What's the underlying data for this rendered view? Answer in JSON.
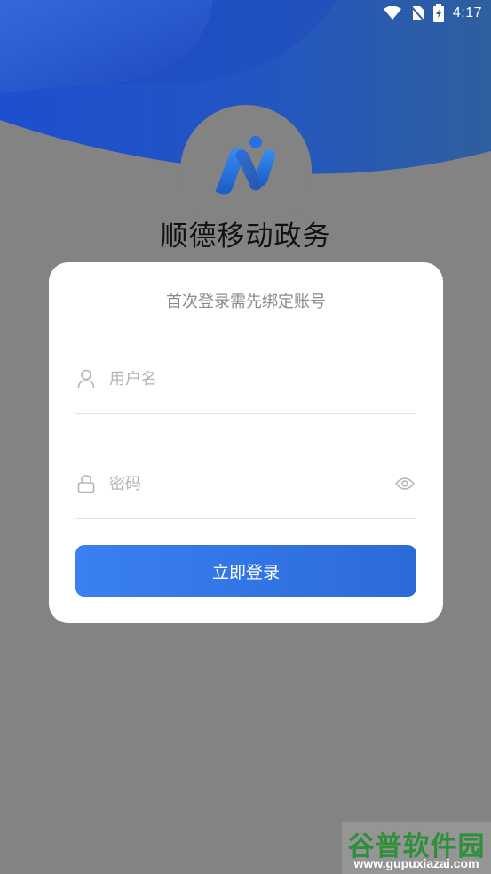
{
  "status_bar": {
    "time": "4:17",
    "icons": [
      "wifi-icon",
      "no-sim-icon",
      "battery-charging-icon"
    ]
  },
  "app": {
    "title": "顺德移动政务",
    "logo_icon": "app-logo-icon",
    "accent_color": "#2a6fe0"
  },
  "login_card": {
    "heading": "首次登录需先绑定账号",
    "username": {
      "placeholder": "用户名",
      "value": "",
      "icon": "user-icon"
    },
    "password": {
      "placeholder": "密码",
      "value": "",
      "icon": "lock-icon",
      "toggle_icon": "eye-icon"
    },
    "submit_label": "立即登录"
  },
  "watermark": {
    "title": "谷普软件园",
    "url": "www.gupuxiazai.com"
  }
}
